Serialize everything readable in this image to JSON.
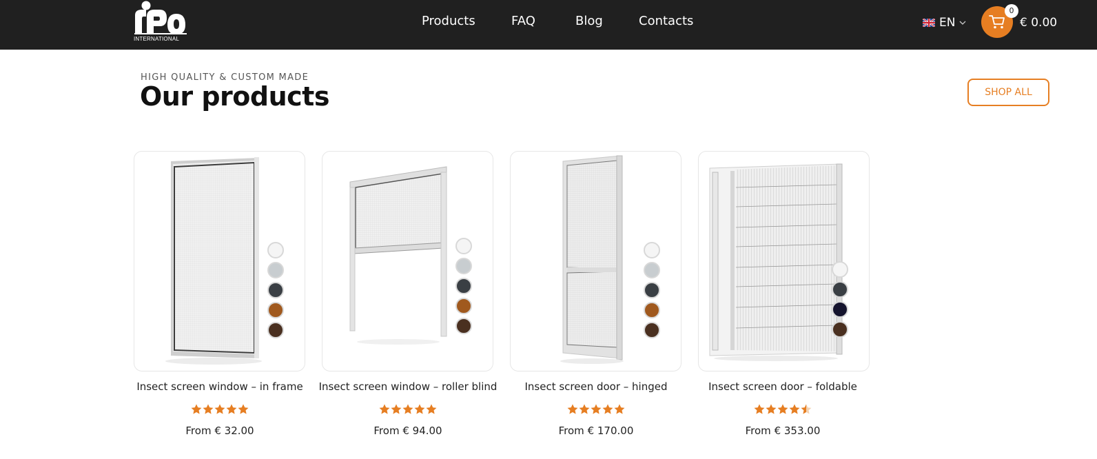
{
  "header": {
    "logo": {
      "brand": "rIPo",
      "subtitle": "INTERNATIONAL"
    },
    "nav": [
      {
        "label": "Products"
      },
      {
        "label": "FAQ"
      },
      {
        "label": "Blog"
      },
      {
        "label": "Contacts"
      }
    ],
    "language": {
      "code": "EN",
      "flag_icon": "uk-flag-icon"
    },
    "cart": {
      "icon": "cart-icon",
      "count": "0",
      "total": "€ 0.00",
      "color": "#e67e22"
    }
  },
  "section": {
    "eyebrow": "HIGH QUALITY & CUSTOM MADE",
    "title": "Our products",
    "shop_all": "SHOP ALL"
  },
  "colors": {
    "accent": "#e67e22",
    "header_bg": "#202020"
  },
  "products": [
    {
      "name": "Insect screen window – in frame",
      "price_prefix": "From",
      "price": "€ 32.00",
      "rating": 5,
      "swatches": [
        "#f5f5f5",
        "#c8cdd0",
        "#3a3f44",
        "#a0591e",
        "#4a3020"
      ]
    },
    {
      "name": "Insect screen window – roller blind",
      "price_prefix": "From",
      "price": "€ 94.00",
      "rating": 5,
      "swatches": [
        "#f5f5f5",
        "#c8cdd0",
        "#3a3f44",
        "#a0591e",
        "#4a3020"
      ]
    },
    {
      "name": "Insect screen door – hinged",
      "price_prefix": "From",
      "price": "€ 170.00",
      "rating": 5,
      "swatches": [
        "#f5f5f5",
        "#c8cdd0",
        "#3a3f44",
        "#a0591e",
        "#4a3020"
      ]
    },
    {
      "name": "Insect screen door – foldable",
      "price_prefix": "From",
      "price": "€ 353.00",
      "rating": 4.5,
      "swatches": [
        "#f5f5f5",
        "#3a3f44",
        "#15142e",
        "#4a3020"
      ]
    }
  ]
}
